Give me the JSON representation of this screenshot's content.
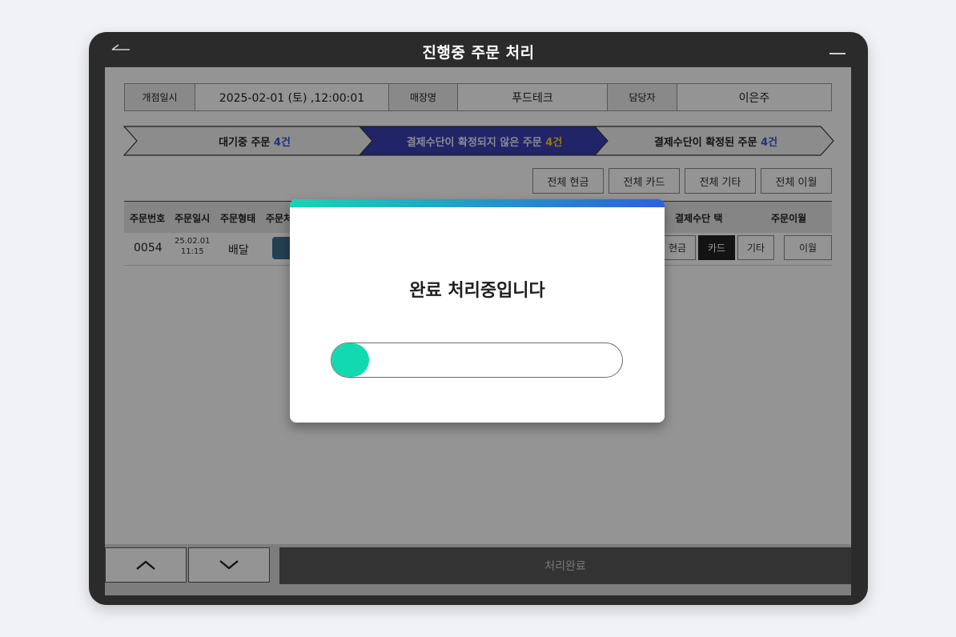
{
  "window": {
    "title": "진행중 주문 처리",
    "back_icon": "back-arrow-icon",
    "minimize_icon": "minimize-icon"
  },
  "info": {
    "open_label": "개점일시",
    "open_value": "2025-02-01 (토) ,12:00:01",
    "store_label": "매장명",
    "store_value": "푸드테크",
    "manager_label": "담당자",
    "manager_value": "이은주"
  },
  "steps": [
    {
      "label": "대기중 주문",
      "count": "4건"
    },
    {
      "label": "결제수단이 확정되지 않은 주문",
      "count": "4건"
    },
    {
      "label": "결제수단이 확정된 주문",
      "count": "4건"
    }
  ],
  "bulk_buttons": [
    "전체 현금",
    "전체 카드",
    "전체 기타",
    "전체 이월"
  ],
  "table": {
    "headers": [
      "주문번호",
      "주문일시",
      "주문형태",
      "주문처",
      "결제수단 택",
      "주문이월"
    ],
    "rows": [
      {
        "order_no": "0054",
        "date": "25.02.01",
        "time": "11:15",
        "type": "배달",
        "payment_options": [
          "현금",
          "카드",
          "기타"
        ],
        "selected_payment": "카드",
        "carryover": "이월"
      }
    ]
  },
  "bottom": {
    "up_icon": "chevron-up-icon",
    "down_icon": "chevron-down-icon",
    "complete_label": "처리완료"
  },
  "modal": {
    "message": "완료 처리중입니다",
    "progress": 0.13
  },
  "colors": {
    "accent_blue": "#3a3fb0",
    "accent_mint": "#13d9b0",
    "count_yellow": "#ffd21f"
  }
}
